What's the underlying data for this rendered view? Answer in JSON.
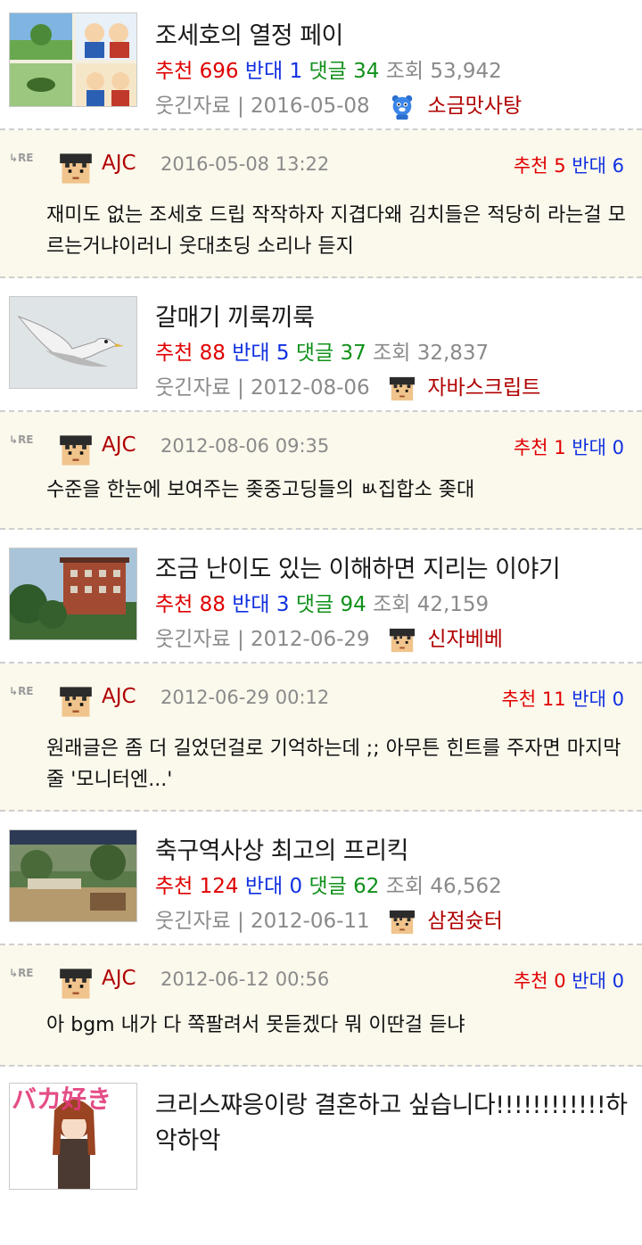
{
  "labels": {
    "recommend": "추천",
    "oppose": "반대",
    "comments": "댓글",
    "views": "조회",
    "re": "RE"
  },
  "colors": {
    "red": "#e00000",
    "blue": "#1030e0",
    "green": "#10901a",
    "meta": "#8a8a8a",
    "comment_bg": "#fbf8ec"
  },
  "posts": [
    {
      "title": "조세호의 열정 페이",
      "recommend": "696",
      "oppose": "1",
      "comments": "34",
      "views": "53,942",
      "category": "웃긴자료",
      "date": "2016-05-08",
      "author": "소금맛사탕",
      "icon": "blue-bear-icon"
    },
    {
      "title": "갈매기 끼룩끼룩",
      "recommend": "88",
      "oppose": "5",
      "comments": "37",
      "views": "32,837",
      "category": "웃긴자료",
      "date": "2012-08-06",
      "author": "자바스크립트",
      "icon": "pixel-face-icon"
    },
    {
      "title": "조금 난이도 있는 이해하면 지리는 이야기",
      "recommend": "88",
      "oppose": "3",
      "comments": "94",
      "views": "42,159",
      "category": "웃긴자료",
      "date": "2012-06-29",
      "author": "신자베베",
      "icon": "pixel-face-icon"
    },
    {
      "title": "축구역사상 최고의 프리킥",
      "recommend": "124",
      "oppose": "0",
      "comments": "62",
      "views": "46,562",
      "category": "웃긴자료",
      "date": "2012-06-11",
      "author": "삼점슛터",
      "icon": "pixel-face-icon"
    },
    {
      "title": "크리스쨔응이랑 결혼하고 싶습니다!!!!!!!!!!!!하",
      "title_line2": "악하악",
      "side_text": "バカ好き"
    }
  ],
  "replies": [
    {
      "author": "AJC",
      "datetime": "2016-05-08 13:22",
      "recommend": "5",
      "oppose": "6",
      "text": "재미도 없는 조세호 드립 작작하자 지겹다왜 김치들은 적당히 라는걸 모르는거냐이러니 웃대초딩 소리나 듣지"
    },
    {
      "author": "AJC",
      "datetime": "2012-08-06 09:35",
      "recommend": "1",
      "oppose": "0",
      "text": "수준을 한눈에 보여주는 좆중고딩들의 ㅄ집합소 좆대"
    },
    {
      "author": "AJC",
      "datetime": "2012-06-29 00:12",
      "recommend": "11",
      "oppose": "0",
      "text": "원래글은 좀 더 길었던걸로 기억하는데 ;; 아무튼 힌트를 주자면 마지막줄 '모니터엔...'"
    },
    {
      "author": "AJC",
      "datetime": "2012-06-12 00:56",
      "recommend": "0",
      "oppose": "0",
      "text": "아 bgm 내가 다 쪽팔려서 못듣겠다 뭐 이딴걸 듣냐"
    }
  ]
}
